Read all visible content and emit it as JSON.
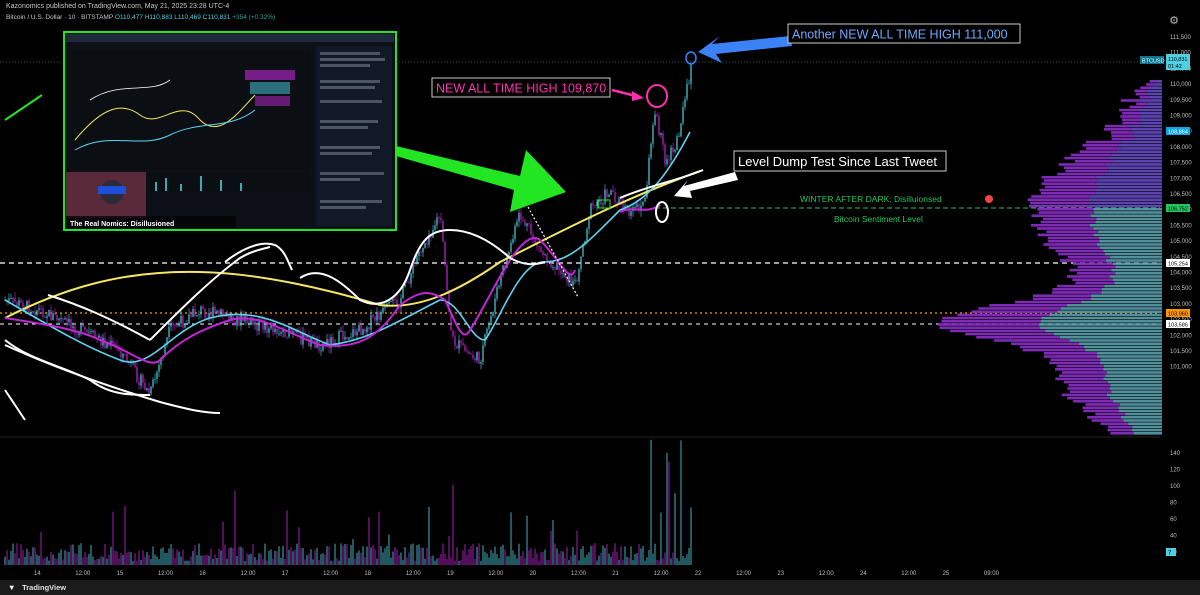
{
  "header": {
    "published": "Kazonomics published on TradingView.com, May 21, 2025 23:28 UTC-4",
    "symbol": "Bitcoin / U.S. Dollar · 10 · BITSTAMP",
    "ohlc": "O110,477 H110,883 L110,469 C110,831",
    "change": "+354 (+0.32%)"
  },
  "annotations": {
    "ath_new": "Another NEW ALL TIME HIGH 111,000",
    "ath_old": "NEW ALL TIME HIGH 109,870",
    "level_dump": "Level Dump Test Since Last Tweet",
    "winter": "WINTER AFTER DARK: Disilluionsed",
    "sentiment": "Bitcoin Sentiment Level",
    "inset_caption": "The Real Nomics: Disillusioned"
  },
  "price_axis": {
    "ticks": [
      "111,500",
      "111,000",
      "110,500",
      "110,000",
      "109,500",
      "109,000",
      "108,500",
      "108,000",
      "107,500",
      "107,000",
      "106,500",
      "106,000",
      "105,500",
      "105,000",
      "104,500",
      "104,000",
      "103,500",
      "103,000",
      "102,500",
      "102,000",
      "101,500",
      "101,000"
    ],
    "labels": {
      "symbol_tag": "BTCUSD",
      "last": "110,831",
      "timer": "01:42",
      "blue_level": "108,864",
      "green_level": "106,752",
      "white_level": "105,254",
      "orange_level": "103,960",
      "low_level": "103,586"
    }
  },
  "volume_axis": {
    "ticks": [
      "140",
      "120",
      "100",
      "80",
      "60",
      "40",
      "20"
    ],
    "last": "7"
  },
  "time_axis": {
    "ticks": [
      "14",
      "12:00",
      "15",
      "12:00",
      "16",
      "12:00",
      "17",
      "12:00",
      "18",
      "12:00",
      "19",
      "12:00",
      "20",
      "12:00",
      "21",
      "12:00",
      "22",
      "12:00",
      "23",
      "12:00",
      "24",
      "12:00",
      "25",
      "09:00"
    ]
  },
  "footer": {
    "brand": "TradingView"
  },
  "colors": {
    "up": "#4dd0e1",
    "down": "#c026d3",
    "ema_yellow": "#f5e663",
    "ema_cyan": "#5ed3f3",
    "annotation_green": "#22e622",
    "annotation_blue": "#3b82f6",
    "annotation_pink": "#ff2fb0"
  }
}
